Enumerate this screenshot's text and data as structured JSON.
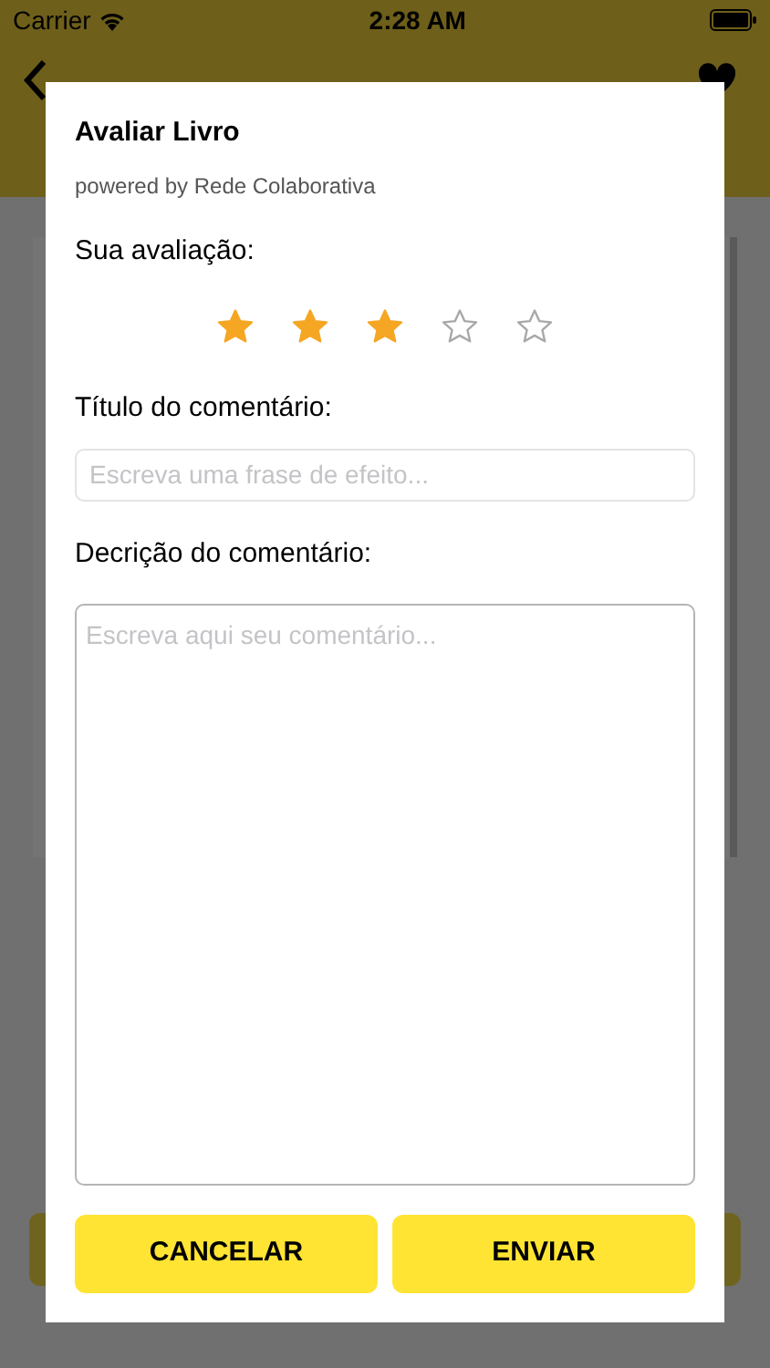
{
  "status_bar": {
    "carrier": "Carrier",
    "time": "2:28 AM"
  },
  "dialog": {
    "title": "Avaliar Livro",
    "subtitle": "powered by Rede Colaborativa",
    "rating": {
      "label": "Sua avaliação:",
      "stars": 3
    },
    "title_field": {
      "label": "Título do comentário:",
      "placeholder": "Escreva uma frase de efeito..."
    },
    "description_field": {
      "label": "Decrição do comentário:",
      "placeholder": "Escreva aqui seu comentário..."
    },
    "buttons": [
      "CANCELAR",
      "ENVIAR"
    ]
  }
}
